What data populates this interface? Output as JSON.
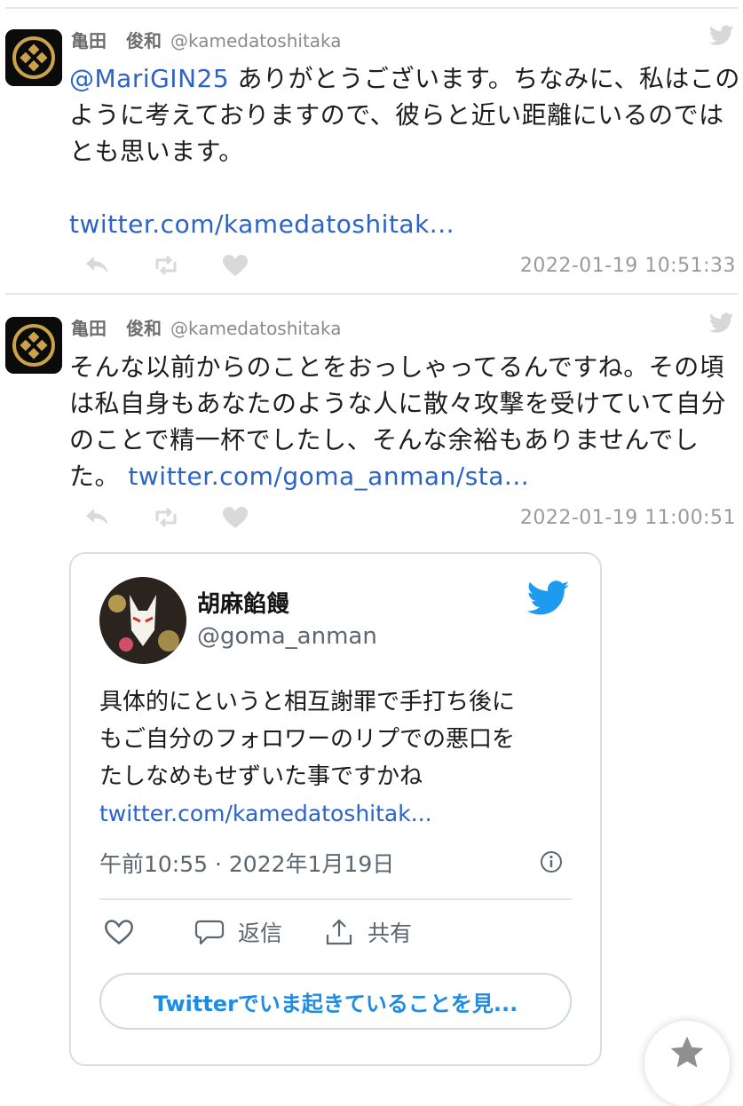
{
  "tweets": [
    {
      "author_family": "亀田",
      "author_given": "俊和",
      "handle": "@kamedatoshitaka",
      "mention": "@MariGIN25",
      "text_line1": " ありがとうございます。ちなみに、私はこの",
      "text_line2": "ように考えておりますので、彼らと近い距離にいるのでは",
      "text_line3": "とも思います。",
      "link": "twitter.com/kamedatoshitak...",
      "timestamp": "2022-01-19 10:51:33"
    },
    {
      "author_family": "亀田",
      "author_given": "俊和",
      "handle": "@kamedatoshitaka",
      "text_line1": "そんな以前からのことをおっしゃってるんですね。その頃",
      "text_line2": "は私自身もあなたのような人に散々攻撃を受けていて自分",
      "text_line3": "のことで精一杯でしたし、そんな余裕もありませんでし",
      "text_line4": "た。",
      "link": "twitter.com/goma_anman/sta...",
      "timestamp": "2022-01-19 11:00:51"
    }
  ],
  "embed": {
    "name": "胡麻餡饅",
    "handle": "@goma_anman",
    "text_line1": "具体的にというと相互謝罪で手打ち後に",
    "text_line2": "もご自分のフォロワーのリプでの悪口を",
    "text_line3": "たしなめもせずいた事ですかね",
    "link": "twitter.com/kamedatoshitak...",
    "meta": "午前10:55 · 2022年1月19日",
    "reply_label": "返信",
    "share_label": "共有",
    "more_button": "Twitterでいま起きていることを見..."
  },
  "colors": {
    "link": "#2b63c6",
    "twitter_blue": "#1d9bf0",
    "muted": "#9a9a9a"
  }
}
